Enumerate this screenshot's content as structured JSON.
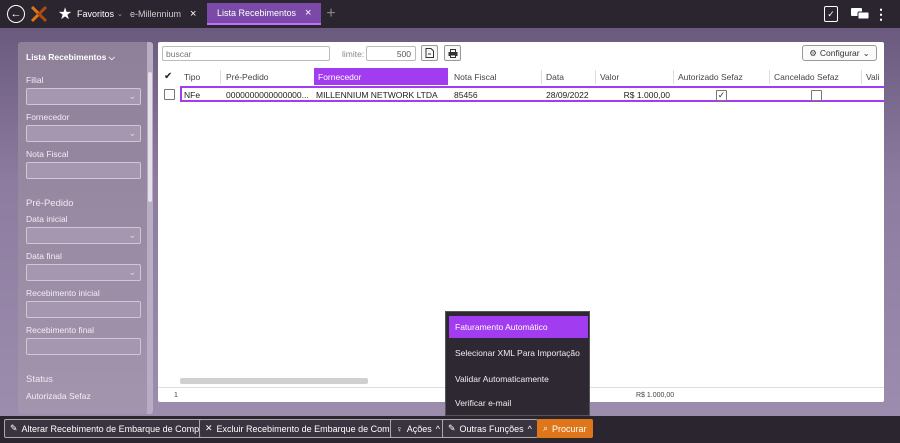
{
  "topbar": {
    "favoritos_label": "Favoritos",
    "tabs": [
      {
        "label": "e-Millennium"
      },
      {
        "label": "Lista Recebimentos"
      }
    ],
    "close_glyph": "×",
    "add_glyph": "+"
  },
  "sidebar": {
    "title": "Lista Recebimentos",
    "filial_label": "Filial",
    "fornecedor_label": "Fornecedor",
    "nota_fiscal_label": "Nota Fiscal",
    "pre_pedido_section": "Pré-Pedido",
    "data_inicial_label": "Data inicial",
    "data_final_label": "Data final",
    "recebimento_inicial_label": "Recebimento inicial",
    "recebimento_final_label": "Recebimento final",
    "status_section": "Status",
    "autorizada_sefaz_label": "Autorizada Sefaz"
  },
  "toolbar": {
    "search_placeholder": "buscar",
    "limite_label": "limite:",
    "limite_value": "500",
    "configurar_label": "Configurar"
  },
  "grid": {
    "headers": [
      "Tipo",
      "Pré-Pedido",
      "Fornecedor",
      "Nota Fiscal",
      "Data",
      "Valor",
      "Autorizado Sefaz",
      "Cancelado Sefaz",
      "Vali"
    ],
    "rows": [
      {
        "tipo": "NFe",
        "pre_pedido": "0000000000000000...",
        "fornecedor": "MILLENNIUM NETWORK LTDA",
        "nota_fiscal": "85456",
        "data": "28/09/2022",
        "valor": "R$ 1.000,00",
        "autorizado_sefaz": true,
        "cancelado_sefaz": false
      }
    ],
    "footer_count": "1",
    "footer_total": "R$ 1.000,00"
  },
  "menu": {
    "items": [
      "Faturamento Automático",
      "Selecionar XML Para Importação",
      "Validar Automaticamente",
      "Verificar e-mail"
    ]
  },
  "bottombar": {
    "alterar": "Alterar Recebimento de Embarque de Compra",
    "excluir": "Excluir Recebimento de Embarque de Compra",
    "acoes": "Ações",
    "outras": "Outras Funções",
    "procurar": "Procurar"
  },
  "colors": {
    "accent": "#a23cf0",
    "orange": "#e0761a",
    "dark": "#2b2530"
  }
}
